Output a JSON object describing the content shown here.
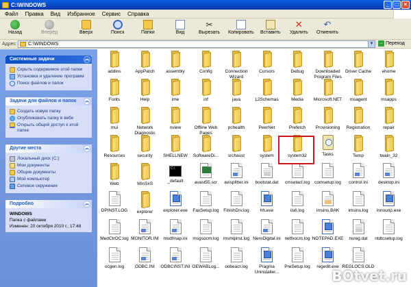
{
  "window": {
    "title": "C:\\WINDOWS"
  },
  "menu": [
    "Файл",
    "Правка",
    "Вид",
    "Избранное",
    "Сервис",
    "Справка"
  ],
  "toolbar": {
    "back": "Назад",
    "forward": "Вперёд",
    "up": "Вверх",
    "search": "Поиск",
    "folders": "Папки",
    "view": "Вид",
    "cut": "Вырезать",
    "copy": "Копировать",
    "paste": "Вставить",
    "delete": "Удалить",
    "undo": "Отменить"
  },
  "address": {
    "label": "Адрес:",
    "value": "C:\\WINDOWS",
    "go": "Переход"
  },
  "left": {
    "system_tasks": {
      "title": "Системные задачи",
      "items": [
        "Скрыть содержимое этой папки",
        "Установка и удаление программ",
        "Поиск файлов и папок"
      ]
    },
    "file_tasks": {
      "title": "Задачи для файлов и папок",
      "items": [
        "Создать новую папку",
        "Опубликовать папку в вебе",
        "Открыть общий доступ к этой папке"
      ]
    },
    "other_places": {
      "title": "Другие места",
      "items": [
        "Локальный диск (C:)",
        "Мои документы",
        "Общие документы",
        "Мой компьютер",
        "Сетевое окружение"
      ]
    },
    "details": {
      "title": "Подробно",
      "name": "WINDOWS",
      "type": "Папка с файлами",
      "modified": "Изменен: 20 октября 2010 г., 17:48"
    }
  },
  "items": [
    {
      "label": "addins",
      "kind": "folder"
    },
    {
      "label": "AppPatch",
      "kind": "folder"
    },
    {
      "label": "assembly",
      "kind": "folder"
    },
    {
      "label": "Config",
      "kind": "folder"
    },
    {
      "label": "Connection Wizard",
      "kind": "folder"
    },
    {
      "label": "Cursors",
      "kind": "folder"
    },
    {
      "label": "Debug",
      "kind": "folder"
    },
    {
      "label": "Downloaded Program Files",
      "kind": "folder"
    },
    {
      "label": "Driver Cache",
      "kind": "folder"
    },
    {
      "label": "ehome",
      "kind": "folder"
    },
    {
      "label": "Fonts",
      "kind": "folder"
    },
    {
      "label": "Help",
      "kind": "folder"
    },
    {
      "label": "ime",
      "kind": "folder"
    },
    {
      "label": "inf",
      "kind": "folder"
    },
    {
      "label": "java",
      "kind": "folder"
    },
    {
      "label": "L2Schemas",
      "kind": "folder"
    },
    {
      "label": "Media",
      "kind": "folder"
    },
    {
      "label": "Microsoft.NET",
      "kind": "folder"
    },
    {
      "label": "msagent",
      "kind": "folder"
    },
    {
      "label": "msapps",
      "kind": "folder"
    },
    {
      "label": "mui",
      "kind": "folder"
    },
    {
      "label": "Network Diagnostic",
      "kind": "folder"
    },
    {
      "label": "nview",
      "kind": "folder"
    },
    {
      "label": "Offline Web Pages",
      "kind": "folder"
    },
    {
      "label": "pchealth",
      "kind": "folder"
    },
    {
      "label": "PeerNet",
      "kind": "folder"
    },
    {
      "label": "Prefetch",
      "kind": "folder"
    },
    {
      "label": "Provisioning",
      "kind": "folder"
    },
    {
      "label": "Registration",
      "kind": "folder"
    },
    {
      "label": "repair",
      "kind": "folder"
    },
    {
      "label": "Resources",
      "kind": "folder"
    },
    {
      "label": "security",
      "kind": "folder"
    },
    {
      "label": "SHELLNEW",
      "kind": "folder"
    },
    {
      "label": "SoftwareDi...",
      "kind": "folder"
    },
    {
      "label": "srchasst",
      "kind": "folder"
    },
    {
      "label": "system",
      "kind": "folder"
    },
    {
      "label": "system32",
      "kind": "folder"
    },
    {
      "label": "Tasks",
      "kind": "tasks"
    },
    {
      "label": "Temp",
      "kind": "folder"
    },
    {
      "label": "twain_32",
      "kind": "folder"
    },
    {
      "label": "Web",
      "kind": "folder"
    },
    {
      "label": "WinSxS",
      "kind": "folder"
    },
    {
      "label": "_default",
      "kind": "cmd"
    },
    {
      "label": "avast55.scr",
      "kind": "scr"
    },
    {
      "label": "avisplitter.ini",
      "kind": "ini"
    },
    {
      "label": "bootstat.dat",
      "kind": "dat"
    },
    {
      "label": "cmsetacl.log",
      "kind": "txt"
    },
    {
      "label": "comsetup.log",
      "kind": "txt"
    },
    {
      "label": "control.ini",
      "kind": "ini"
    },
    {
      "label": "desktop.ini",
      "kind": "ini"
    },
    {
      "label": "DPINST.LOG",
      "kind": "txt"
    },
    {
      "label": "explorer",
      "kind": "folder"
    },
    {
      "label": "explorer.exe",
      "kind": "exe"
    },
    {
      "label": "FaxSetup.log",
      "kind": "txt"
    },
    {
      "label": "FinishDrv.log",
      "kind": "txt"
    },
    {
      "label": "hh.exe",
      "kind": "exe"
    },
    {
      "label": "iis6.log",
      "kind": "txt"
    },
    {
      "label": "imsins.BAK",
      "kind": "bak"
    },
    {
      "label": "imsins.log",
      "kind": "txt"
    },
    {
      "label": "innounp.exe",
      "kind": "exe"
    },
    {
      "label": "MedCtrOC.log",
      "kind": "txt"
    },
    {
      "label": "MONITOR.INI",
      "kind": "ini"
    },
    {
      "label": "msdfmap.ini",
      "kind": "ini"
    },
    {
      "label": "msgsocm.log",
      "kind": "txt"
    },
    {
      "label": "msmqinst.log",
      "kind": "txt"
    },
    {
      "label": "NeroDigital.ini",
      "kind": "ini"
    },
    {
      "label": "netfxocm.log",
      "kind": "txt"
    },
    {
      "label": "NOTEPAD.EXE",
      "kind": "exe"
    },
    {
      "label": "nsreg.dat",
      "kind": "dat"
    },
    {
      "label": "ntdtcsetup.log",
      "kind": "txt"
    },
    {
      "label": "ocgen.log",
      "kind": "txt"
    },
    {
      "label": "ODBC.INI",
      "kind": "ini"
    },
    {
      "label": "ODBCINST.INI",
      "kind": "ini"
    },
    {
      "label": "OEWABLog...",
      "kind": "txt"
    },
    {
      "label": "oobeact.log",
      "kind": "txt"
    },
    {
      "label": "Pragma Uninstaller...",
      "kind": "exe"
    },
    {
      "label": "PreSetup.log",
      "kind": "txt"
    },
    {
      "label": "regedit.exe",
      "kind": "exe"
    },
    {
      "label": "REGLOCS.OLD",
      "kind": "txt"
    }
  ],
  "watermark": "Otvet.ru",
  "watermark_b": "B"
}
